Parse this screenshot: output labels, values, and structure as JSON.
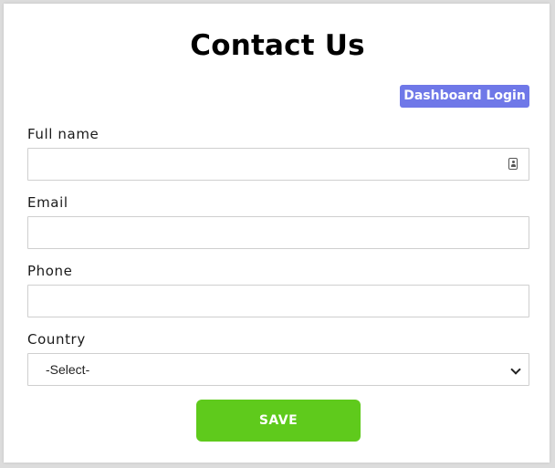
{
  "page": {
    "title": "Contact Us"
  },
  "header": {
    "dashboard_login_label": "Dashboard Login"
  },
  "form": {
    "full_name": {
      "label": "Full name",
      "value": "",
      "placeholder": ""
    },
    "email": {
      "label": "Email",
      "value": "",
      "placeholder": ""
    },
    "phone": {
      "label": "Phone",
      "value": "",
      "placeholder": ""
    },
    "country": {
      "label": "Country",
      "selected": "-Select-"
    },
    "save_label": "SAVE"
  },
  "icons": {
    "full_name_field_icon": "contact-card-icon",
    "country_dropdown_icon": "chevron-down-icon"
  },
  "colors": {
    "dashboard_button": "#6f78e8",
    "save_button": "#5fca1c",
    "field_border": "#cfcfcf",
    "background": "#ffffff"
  }
}
